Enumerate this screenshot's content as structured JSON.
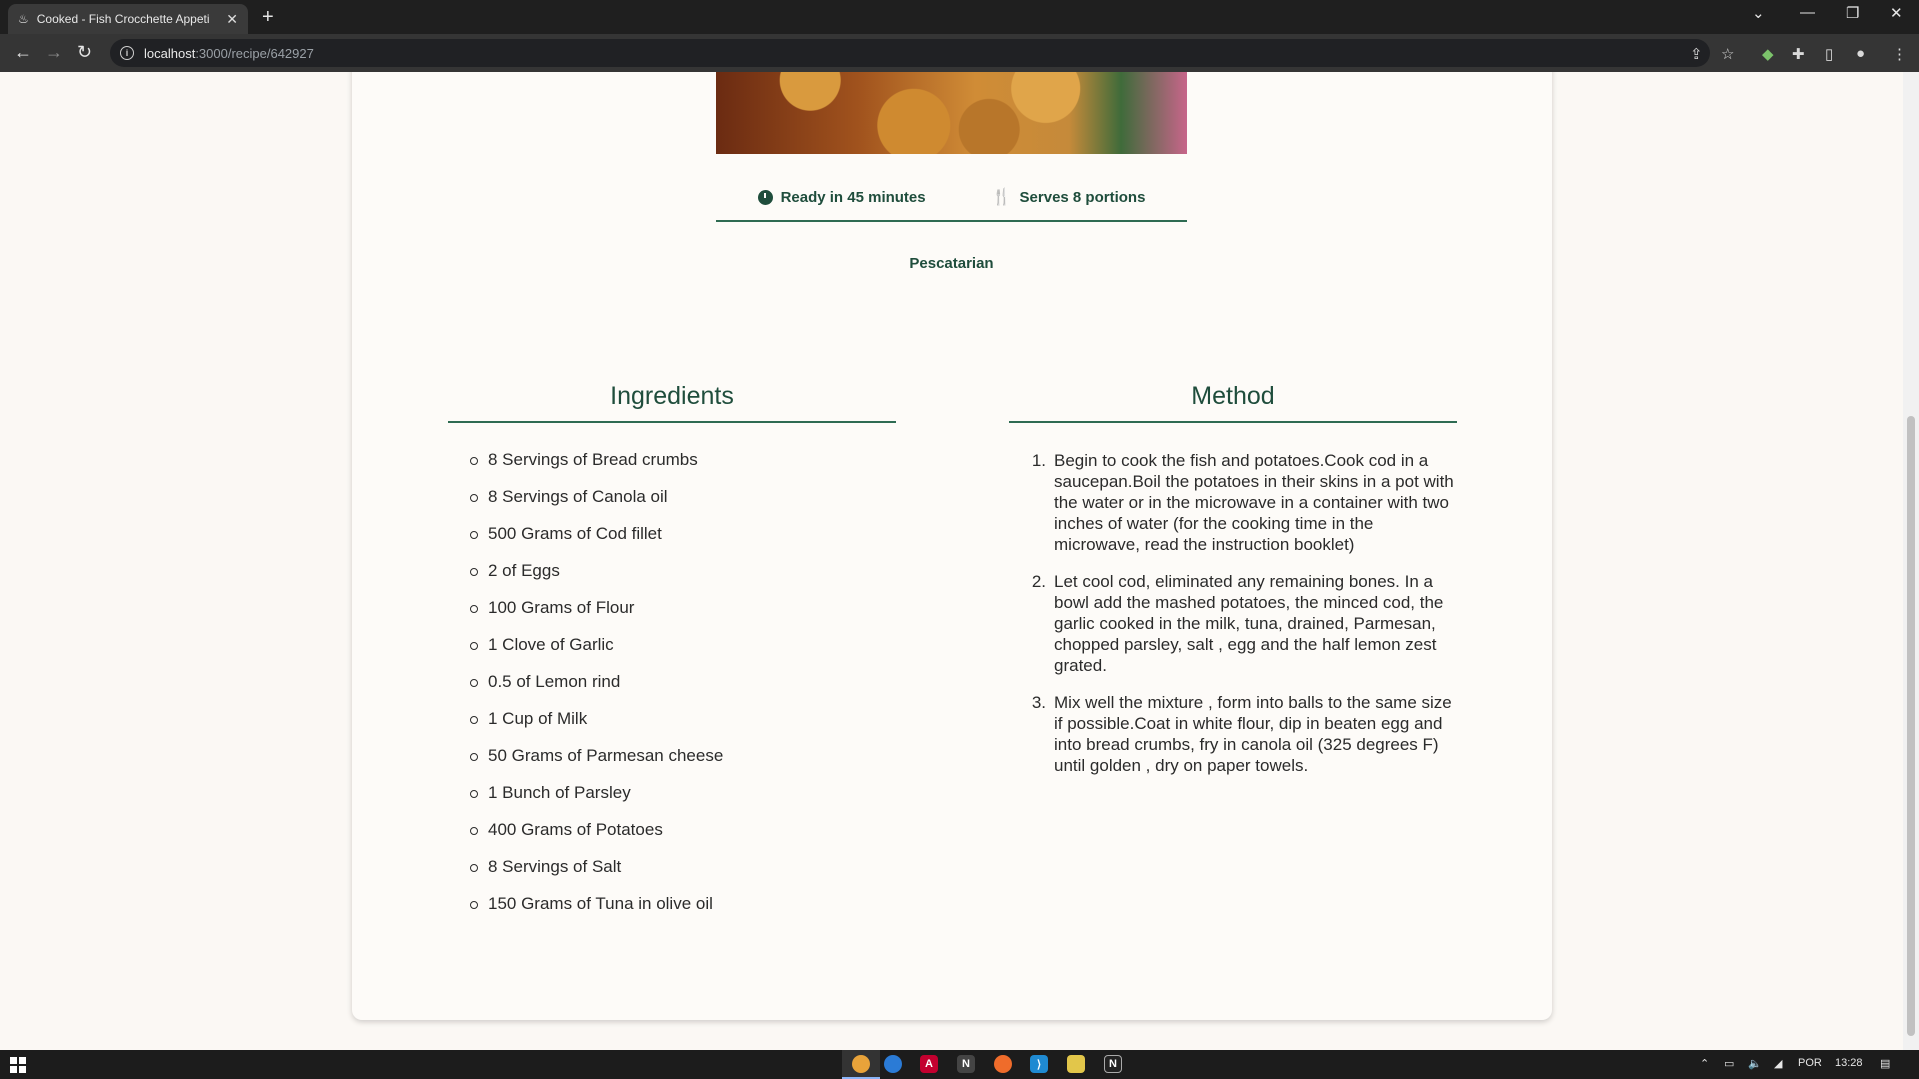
{
  "browser": {
    "tab_title": "Cooked - Fish Crocchette Appeti",
    "tab_close": "✕",
    "new_tab": "+",
    "url_host": "localhost",
    "url_path": ":3000/recipe/642927"
  },
  "recipe": {
    "ready_text": "Ready in 45 minutes",
    "serves_text": "Serves 8 portions",
    "diet": "Pescatarian"
  },
  "ingredients": {
    "title": "Ingredients",
    "items": [
      "8 Servings of Bread crumbs",
      "8 Servings of Canola oil",
      "500 Grams of Cod fillet",
      "2 of Eggs",
      "100 Grams of Flour",
      "1 Clove of Garlic",
      "0.5 of Lemon rind",
      "1 Cup of Milk",
      "50 Grams of Parmesan cheese",
      "1 Bunch of Parsley",
      "400 Grams of Potatoes",
      "8 Servings of Salt",
      "150 Grams of Tuna in olive oil"
    ]
  },
  "method": {
    "title": "Method",
    "steps": [
      {
        "num": "1.",
        "text": "Begin to cook the fish and potatoes.Cook cod in a saucepan.Boil the potatoes in their skins in a pot with the water or in the microwave in a container with two inches of water (for the cooking time in the microwave, read the instruction booklet)"
      },
      {
        "num": "2.",
        "text": "Let cool cod, eliminated any remaining bones. In a bowl add the mashed potatoes, the minced cod, the garlic cooked in the milk, tuna, drained, Parmesan, chopped parsley, salt , egg and the half lemon zest grated."
      },
      {
        "num": "3.",
        "text": "Mix well the mixture , form into balls to the same size if possible.Coat in white flour, dip in beaten egg and into bread crumbs, fry in canola oil (325 degrees F) until golden , dry on paper towels."
      }
    ]
  },
  "taskbar": {
    "language": "POR",
    "time": "13:28"
  },
  "colors": {
    "accent_green": "#1f4d3c",
    "page_bg": "#fbf8f4"
  }
}
